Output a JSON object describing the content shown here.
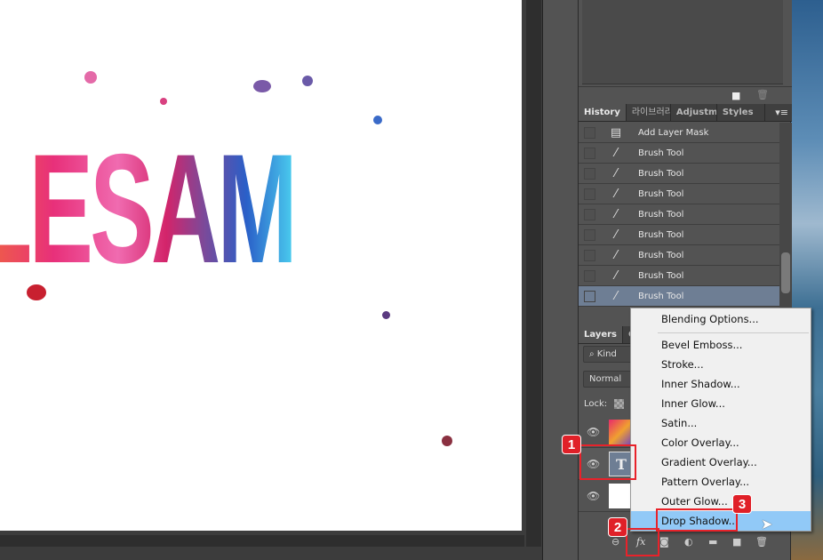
{
  "canvas": {
    "art_text": "LESAM"
  },
  "history_panel": {
    "tabs": [
      "History",
      "라이브러리",
      "Adjustme",
      "Styles"
    ],
    "items": [
      {
        "label": "Add Layer Mask",
        "icon": "document-icon"
      },
      {
        "label": "Brush Tool",
        "icon": "brush-icon"
      },
      {
        "label": "Brush Tool",
        "icon": "brush-icon"
      },
      {
        "label": "Brush Tool",
        "icon": "brush-icon"
      },
      {
        "label": "Brush Tool",
        "icon": "brush-icon"
      },
      {
        "label": "Brush Tool",
        "icon": "brush-icon"
      },
      {
        "label": "Brush Tool",
        "icon": "brush-icon"
      },
      {
        "label": "Brush Tool",
        "icon": "brush-icon"
      },
      {
        "label": "Brush Tool",
        "icon": "brush-icon",
        "selected": true
      }
    ]
  },
  "layers_panel": {
    "tabs": [
      "Layers",
      "Ch"
    ],
    "filter_label": "Kind",
    "blend_mode": "Normal",
    "lock_label": "Lock:",
    "text_layer_glyph": "T",
    "fx_label": "fx"
  },
  "context_menu": {
    "items": [
      "Blending Options...",
      "Bevel  Emboss...",
      "Stroke...",
      "Inner Shadow...",
      "Inner Glow...",
      "Satin...",
      "Color Overlay...",
      "Gradient Overlay...",
      "Pattern Overlay...",
      "Outer Glow...",
      "Drop Shadow..."
    ],
    "highlighted": "Drop Shadow..."
  },
  "annotations": {
    "step1": "1",
    "step2": "2",
    "step3": "3",
    "color": "#e02028"
  }
}
